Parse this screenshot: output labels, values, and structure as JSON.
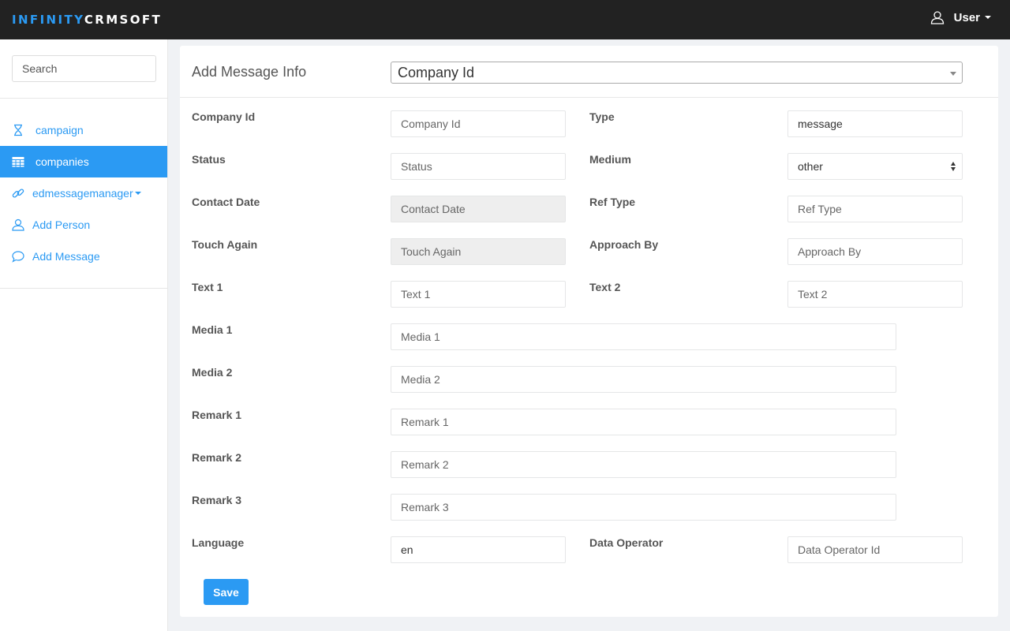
{
  "brand": {
    "part1": "INFINITY",
    "part2": "CRMSOFT"
  },
  "user_menu": {
    "label": "User",
    "icon": "user-icon"
  },
  "sidebar": {
    "search_placeholder": "Search",
    "items": [
      {
        "label": "campaign",
        "icon": "hourglass-icon",
        "active": false
      },
      {
        "label": "companies",
        "icon": "table-icon",
        "active": true
      },
      {
        "label": "edmessagemanager",
        "icon": "link-icon",
        "active": false,
        "dropdown": true
      },
      {
        "label": "Add Person",
        "icon": "user-icon",
        "active": false
      },
      {
        "label": "Add Message",
        "icon": "comment-icon",
        "active": false
      }
    ]
  },
  "panel": {
    "title": "Add Message Info",
    "header_select": "Company Id"
  },
  "form": {
    "company_id": {
      "label": "Company Id",
      "placeholder": "Company Id"
    },
    "type": {
      "label": "Type",
      "value": "message"
    },
    "status": {
      "label": "Status",
      "placeholder": "Status"
    },
    "medium": {
      "label": "Medium",
      "value": "other"
    },
    "contact_date": {
      "label": "Contact Date",
      "placeholder": "Contact Date"
    },
    "ref_type": {
      "label": "Ref Type",
      "placeholder": "Ref Type"
    },
    "touch_again": {
      "label": "Touch Again",
      "placeholder": "Touch Again"
    },
    "approach_by": {
      "label": "Approach By",
      "placeholder": "Approach By"
    },
    "text1": {
      "label": "Text 1",
      "placeholder": "Text 1"
    },
    "text2": {
      "label": "Text 2",
      "placeholder": "Text 2"
    },
    "media1": {
      "label": "Media 1",
      "placeholder": "Media 1"
    },
    "media2": {
      "label": "Media 2",
      "placeholder": "Media 2"
    },
    "remark1": {
      "label": "Remark 1",
      "placeholder": "Remark 1"
    },
    "remark2": {
      "label": "Remark 2",
      "placeholder": "Remark 2"
    },
    "remark3": {
      "label": "Remark 3",
      "placeholder": "Remark 3"
    },
    "language": {
      "label": "Language",
      "value": "en"
    },
    "data_operator": {
      "label": "Data Operator",
      "placeholder": "Data Operator Id"
    },
    "save_label": "Save"
  },
  "colors": {
    "accent": "#2b9af3",
    "topbar": "#222222",
    "background": "#f0f2f5"
  }
}
